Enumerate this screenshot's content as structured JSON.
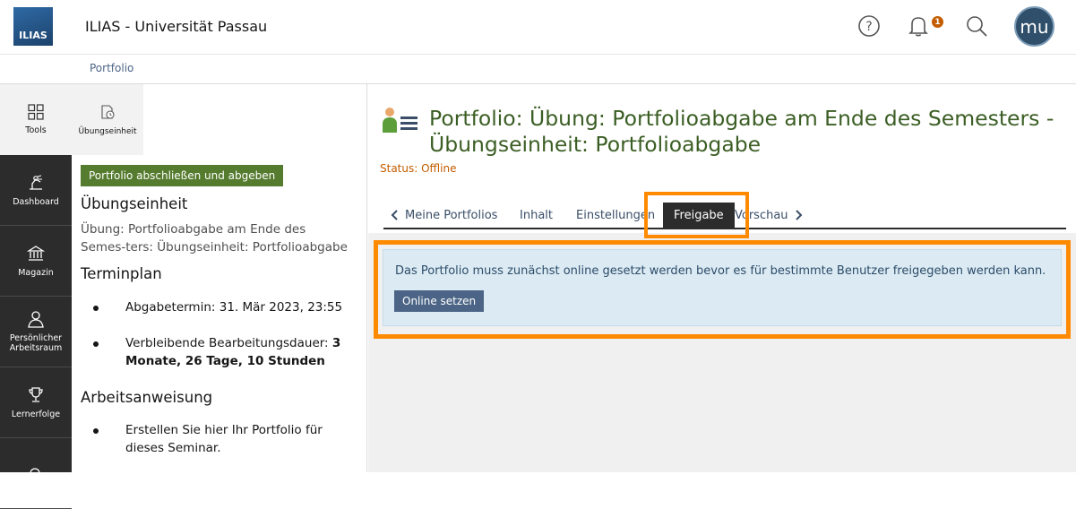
{
  "header": {
    "logo_text": "ILIAS",
    "app_title": "ILIAS - Universität Passau",
    "notification_count": "1",
    "avatar_initials": "mu"
  },
  "breadcrumb": {
    "label": "Portfolio"
  },
  "mainbar": {
    "items": [
      {
        "label": "Tools",
        "icon": "grid-icon"
      },
      {
        "label": "Dashboard",
        "icon": "dashboard-icon"
      },
      {
        "label": "Magazin",
        "icon": "repository-icon"
      },
      {
        "label": "Persönlicher Arbeitsraum",
        "icon": "person-icon"
      },
      {
        "label": "Lernerfolge",
        "icon": "trophy-icon"
      }
    ]
  },
  "slate": {
    "tab_label": "Übungseinheit",
    "submit_button": "Portfolio abschließen und abgeben",
    "heading_unit": "Übungseinheit",
    "unit_text": "Übung: Portfolioabgabe am Ende des Semes-ters: Übungseinheit: Portfolioabgabe",
    "heading_schedule": "Terminplan",
    "deadline": "Abgabetermin: 31. Mär 2023, 23:55",
    "remaining_prefix": "Verbleibende Bearbeitungsdauer: ",
    "remaining_value": "3 Monate, 26 Tage, 10 Stunden",
    "heading_instructions": "Arbeitsanweisung",
    "instruction": "Erstellen Sie hier Ihr Portfolio für dieses Seminar."
  },
  "content": {
    "title": "Portfolio: Übung: Portfolioabgabe am Ende des Semesters - Übungseinheit: Portfolioabgabe",
    "status": "Status: Offline",
    "tabs": {
      "back": "Meine Portfolios",
      "content": "Inhalt",
      "settings": "Einstellungen",
      "share": "Freigabe",
      "preview": "Vorschau"
    },
    "message": "Das Portfolio muss zunächst online gesetzt werden bevor es für bestimmte Benutzer freigegeben werden kann.",
    "online_button": "Online setzen"
  },
  "colors": {
    "highlight": "#ff8a00",
    "title_green": "#3b5e24",
    "status_orange": "#c35d00",
    "info_bg": "#dcebf3"
  }
}
